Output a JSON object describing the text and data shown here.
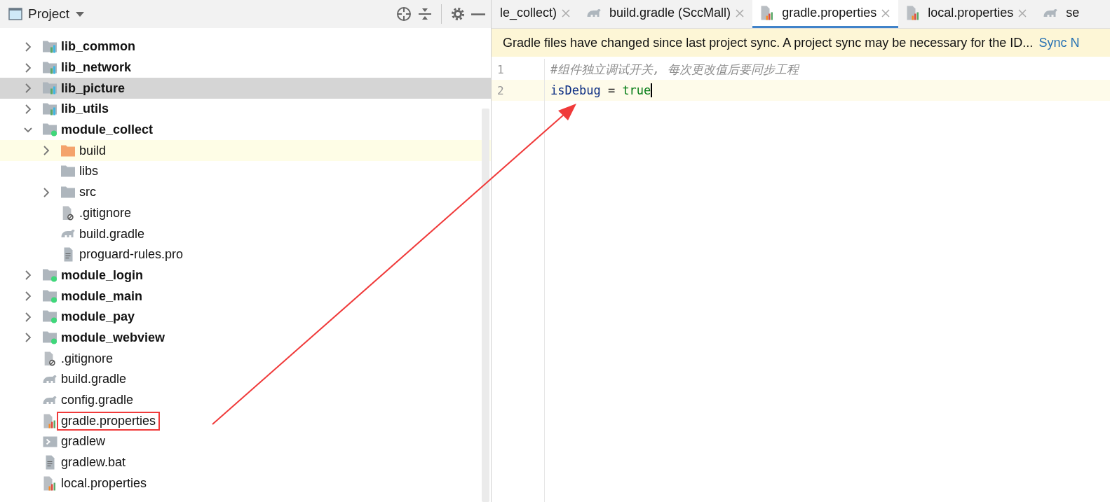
{
  "project_panel": {
    "title": "Project",
    "tree": [
      {
        "label": "lib_common",
        "kind": "library",
        "expanded": false,
        "selected": false,
        "current": false,
        "boxed": false
      },
      {
        "label": "lib_network",
        "kind": "library",
        "expanded": false,
        "selected": false,
        "current": false,
        "boxed": false
      },
      {
        "label": "lib_picture",
        "kind": "library",
        "expanded": false,
        "selected": true,
        "current": false,
        "boxed": false
      },
      {
        "label": "lib_utils",
        "kind": "library",
        "expanded": false,
        "selected": false,
        "current": false,
        "boxed": false
      },
      {
        "label": "module_collect",
        "kind": "module",
        "expanded": true,
        "selected": false,
        "current": false,
        "boxed": false,
        "children": [
          {
            "label": "build",
            "kind": "excluded-folder",
            "expanded": false,
            "selected": false,
            "current": true,
            "boxed": false
          },
          {
            "label": "libs",
            "kind": "folder",
            "selected": false,
            "current": false,
            "boxed": false
          },
          {
            "label": "src",
            "kind": "folder",
            "expanded": false,
            "selected": false,
            "current": false,
            "boxed": false
          },
          {
            "label": ".gitignore",
            "kind": "ignore",
            "selected": false,
            "current": false,
            "boxed": false
          },
          {
            "label": "build.gradle",
            "kind": "gradle",
            "selected": false,
            "current": false,
            "boxed": false
          },
          {
            "label": "proguard-rules.pro",
            "kind": "text",
            "selected": false,
            "current": false,
            "boxed": false
          }
        ]
      },
      {
        "label": "module_login",
        "kind": "module",
        "expanded": false,
        "selected": false,
        "current": false,
        "boxed": false
      },
      {
        "label": "module_main",
        "kind": "module",
        "expanded": false,
        "selected": false,
        "current": false,
        "boxed": false
      },
      {
        "label": "module_pay",
        "kind": "module",
        "expanded": false,
        "selected": false,
        "current": false,
        "boxed": false
      },
      {
        "label": "module_webview",
        "kind": "module",
        "expanded": false,
        "selected": false,
        "current": false,
        "boxed": false
      },
      {
        "label": ".gitignore",
        "kind": "ignore",
        "selected": false,
        "current": false,
        "boxed": false
      },
      {
        "label": "build.gradle",
        "kind": "gradle",
        "selected": false,
        "current": false,
        "boxed": false
      },
      {
        "label": "config.gradle",
        "kind": "gradle",
        "selected": false,
        "current": false,
        "boxed": false
      },
      {
        "label": "gradle.properties",
        "kind": "properties",
        "selected": false,
        "current": false,
        "boxed": true
      },
      {
        "label": "gradlew",
        "kind": "script",
        "selected": false,
        "current": false,
        "boxed": false
      },
      {
        "label": "gradlew.bat",
        "kind": "text",
        "selected": false,
        "current": false,
        "boxed": false
      },
      {
        "label": "local.properties",
        "kind": "properties",
        "selected": false,
        "current": false,
        "boxed": false
      }
    ]
  },
  "editor": {
    "tabs": [
      {
        "label": "le_collect)",
        "kind": "plain",
        "selected": false,
        "closable": true
      },
      {
        "label": "build.gradle (SccMall)",
        "kind": "gradle",
        "selected": false,
        "closable": true
      },
      {
        "label": "gradle.properties",
        "kind": "properties",
        "selected": true,
        "closable": true
      },
      {
        "label": "local.properties",
        "kind": "properties",
        "selected": false,
        "closable": true
      },
      {
        "label": "se",
        "kind": "gradle",
        "selected": false,
        "closable": false
      }
    ],
    "banner": {
      "message": "Gradle files have changed since last project sync. A project sync may be necessary for the ID...",
      "link": "Sync N"
    },
    "lines": [
      {
        "number": "1",
        "current": false,
        "tokens": [
          {
            "kind": "comment",
            "text": "#组件独立调试开关, 每次更改值后要同步工程"
          }
        ]
      },
      {
        "number": "2",
        "current": true,
        "tokens": [
          {
            "kind": "key",
            "text": "isDebug"
          },
          {
            "kind": "plain",
            "text": " = "
          },
          {
            "kind": "value",
            "text": "true"
          }
        ]
      }
    ]
  }
}
